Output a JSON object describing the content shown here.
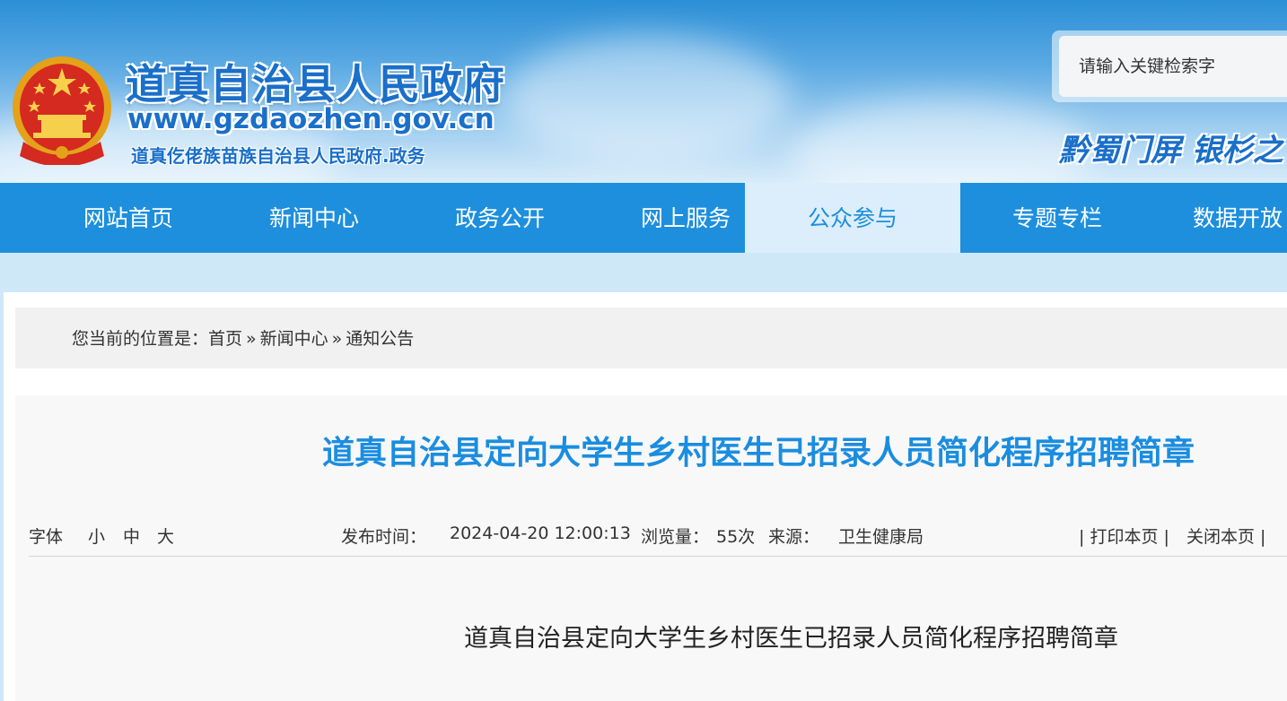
{
  "header": {
    "site_title": "道真自治县人民政府",
    "site_url": "www.gzdaozhen.gov.cn",
    "site_subtitle": "道真仡佬族苗族自治县人民政府.政务",
    "slogan": "黔蜀门屏  银杉之",
    "search_placeholder": "请输入关键检索字"
  },
  "nav": {
    "items": [
      {
        "label": "网站首页"
      },
      {
        "label": "新闻中心"
      },
      {
        "label": "政务公开"
      },
      {
        "label": "网上服务"
      },
      {
        "label": "公众参与"
      },
      {
        "label": "专题专栏"
      },
      {
        "label": "数据开放"
      }
    ],
    "active_index": 4
  },
  "breadcrumb": {
    "prefix": "您当前的位置是：",
    "items": [
      "首页",
      "新闻中心",
      "通知公告"
    ],
    "separator": "»"
  },
  "article": {
    "title": "道真自治县定向大学生乡村医生已招录人员简化程序招聘简章",
    "font_label": "字体",
    "font_small": "小",
    "font_medium": "中",
    "font_large": "大",
    "publish_label": "发布时间：",
    "publish_time": "2024-04-20 12:00:13",
    "views_label": "浏览量：",
    "views": "55次",
    "source_label": "来源：",
    "source": "卫生健康局",
    "print_label": "| 打印本页 |",
    "close_label": "关闭本页 |",
    "body_title": "道真自治县定向大学生乡村医生已招录人员简化程序招聘简章"
  },
  "colors": {
    "nav_bg": "#1d8fdd",
    "nav_active_bg": "#dceefb",
    "title_blue": "#1a8de0",
    "page_bg": "#cfe8f8"
  },
  "icons": {
    "emblem": "national-emblem-icon"
  }
}
